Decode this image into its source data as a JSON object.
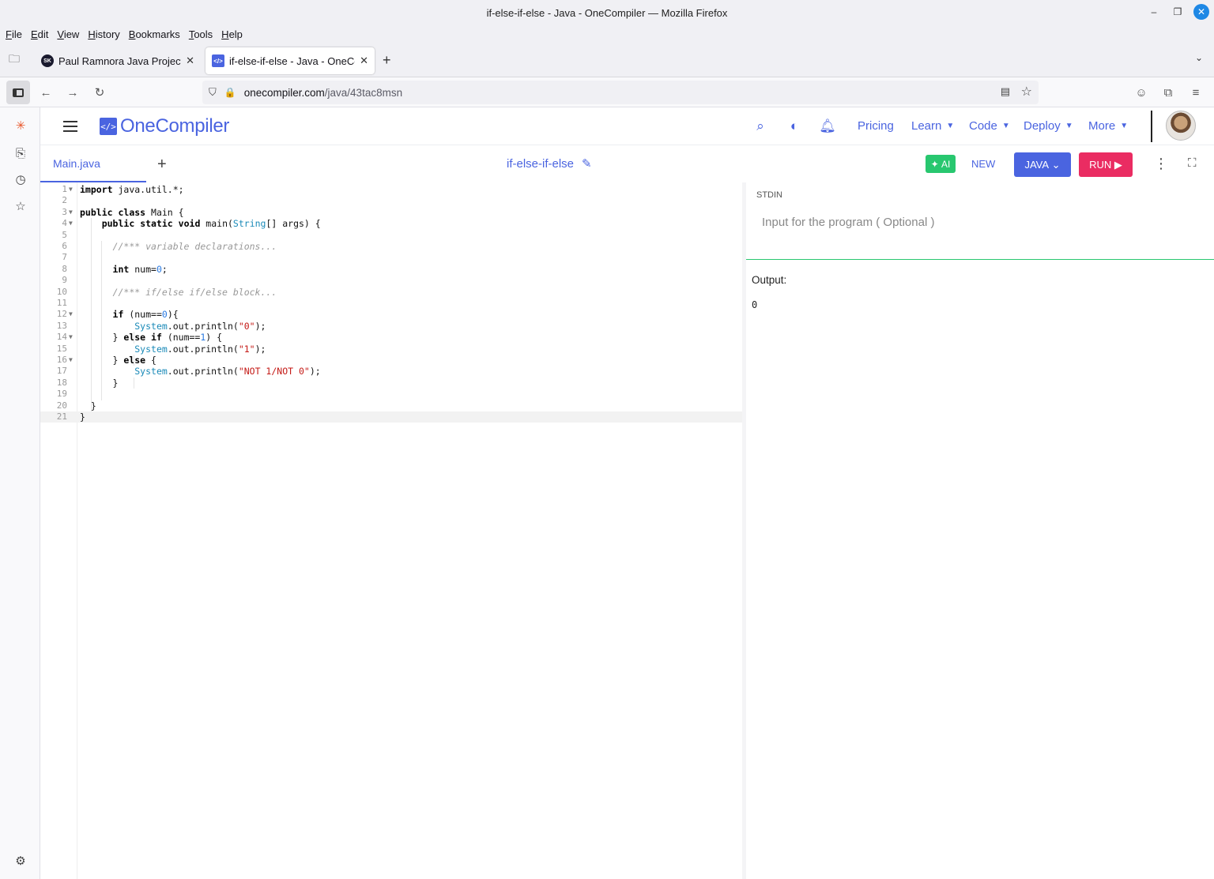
{
  "window": {
    "title": "if-else-if-else - Java - OneCompiler — Mozilla Firefox"
  },
  "menu": [
    {
      "label": "File",
      "key": "F",
      "rest": "ile"
    },
    {
      "label": "Edit",
      "key": "E",
      "rest": "dit"
    },
    {
      "label": "View",
      "key": "V",
      "rest": "iew"
    },
    {
      "label": "History",
      "key": "H",
      "rest": "istory"
    },
    {
      "label": "Bookmarks",
      "key": "B",
      "rest": "ookmarks"
    },
    {
      "label": "Tools",
      "key": "T",
      "rest": "ools"
    },
    {
      "label": "Help",
      "key": "H",
      "rest": "elp"
    }
  ],
  "tabs": [
    {
      "title": "Paul Ramnora Java Project |",
      "favicon": "SK",
      "active": false
    },
    {
      "title": "if-else-if-else - Java - OneCo",
      "favicon": "</>",
      "active": true
    }
  ],
  "urlbar": {
    "host": "onecompiler.com",
    "path": "/java/43tac8msn"
  },
  "oc": {
    "brand": "OneCompiler",
    "nav": [
      "Pricing",
      "Learn",
      "Code",
      "Deploy",
      "More"
    ],
    "file_tab": "Main.java",
    "project_title": "if-else-if-else",
    "ai_label": "AI",
    "new_label": "NEW",
    "lang_label": "JAVA",
    "run_label": "RUN"
  },
  "code_lines": [
    "import java.util.*;",
    "",
    "public class Main {",
    "    public static void main(String[] args) {",
    "",
    "      //*** variable declarations...",
    "",
    "      int num=0;",
    "",
    "      //*** if/else if/else block...",
    "",
    "      if (num==0){",
    "          System.out.println(\"0\");",
    "      } else if (num==1) {",
    "          System.out.println(\"1\");",
    "      } else {",
    "          System.out.println(\"NOT 1/NOT 0\");",
    "      }",
    "",
    "  }",
    "}"
  ],
  "stdin": {
    "label": "STDIN",
    "placeholder": "Input for the program ( Optional )"
  },
  "output": {
    "label": "Output:",
    "value": "0"
  },
  "colors": {
    "accent": "#4a64e0",
    "run": "#ea2c62",
    "ai": "#28c76f"
  }
}
